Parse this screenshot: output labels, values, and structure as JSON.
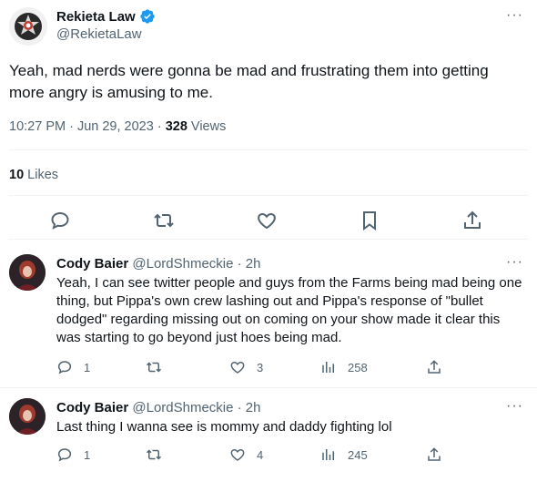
{
  "main_tweet": {
    "author_name": "Rekieta Law",
    "author_handle": "@RekietaLaw",
    "more": "···",
    "text": "Yeah, mad nerds were gonna be mad and frustrating them into getting more angry is amusing to me.",
    "time": "10:27 PM · Jun 29, 2023 · ",
    "views_count": "328",
    "views_label": " Views",
    "likes_count": "10",
    "likes_label": " Likes",
    "verified_color": "#1d9bf0"
  },
  "replies": [
    {
      "name": "Cody Baier",
      "handle": " @LordShmeckie · 2h",
      "more": "···",
      "text": "Yeah, I can see twitter people and guys from the Farms being mad being one thing, but Pippa's own crew lashing out and Pippa's response of \"bullet dodged\" regarding missing out on coming on your show made it clear this was starting to go beyond just hoes being mad.",
      "reply_count": "1",
      "retweet_count": "",
      "like_count": "3",
      "view_count": "258"
    },
    {
      "name": "Cody Baier",
      "handle": " @LordShmeckie · 2h",
      "more": "···",
      "text": "Last thing I wanna see is mommy and daddy fighting lol",
      "reply_count": "1",
      "retweet_count": "",
      "like_count": "4",
      "view_count": "245"
    }
  ]
}
